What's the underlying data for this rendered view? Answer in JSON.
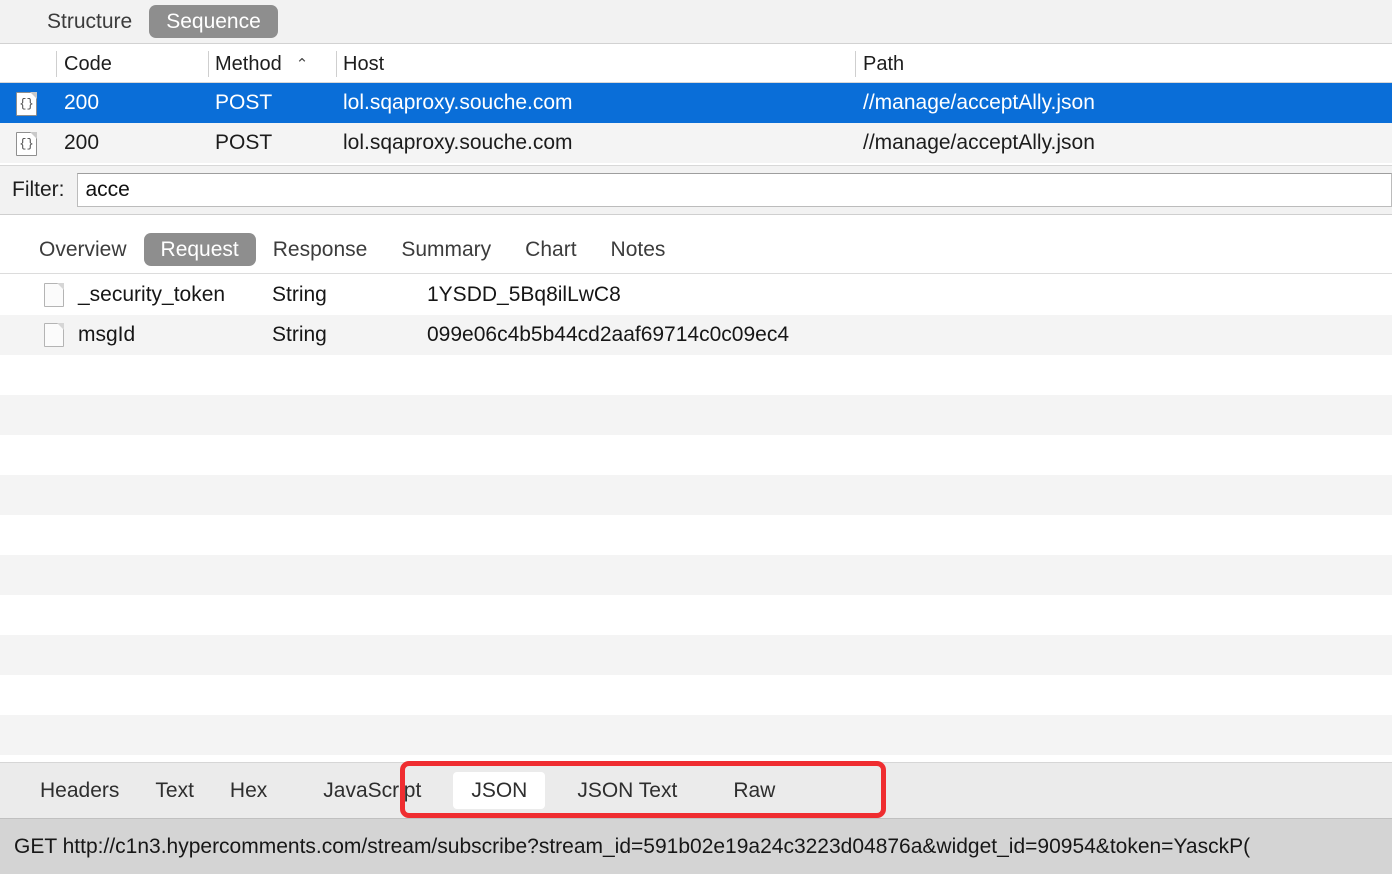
{
  "toolbar": {
    "segments": [
      {
        "label": "Structure",
        "active": false
      },
      {
        "label": "Sequence",
        "active": true
      }
    ]
  },
  "request_list": {
    "columns": [
      {
        "label": "Code"
      },
      {
        "label": "Method",
        "sort_caret": "⌃"
      },
      {
        "label": "Host"
      },
      {
        "label": "Path"
      }
    ],
    "rows": [
      {
        "icon": "json-document-icon",
        "code": "200",
        "method": "POST",
        "host": "lol.sqaproxy.souche.com",
        "path": "//manage/acceptAlly.json",
        "selected": true
      },
      {
        "icon": "json-document-icon",
        "code": "200",
        "method": "POST",
        "host": "lol.sqaproxy.souche.com",
        "path": "//manage/acceptAlly.json",
        "selected": false
      }
    ]
  },
  "filter": {
    "label": "Filter:",
    "value": "acce",
    "placeholder": ""
  },
  "detail_tabs": [
    {
      "label": "Overview",
      "active": false
    },
    {
      "label": "Request",
      "active": true
    },
    {
      "label": "Response",
      "active": false
    },
    {
      "label": "Summary",
      "active": false
    },
    {
      "label": "Chart",
      "active": false
    },
    {
      "label": "Notes",
      "active": false
    }
  ],
  "params": {
    "rows": [
      {
        "icon": "file-icon",
        "name": "_security_token",
        "type": "String",
        "value": "1YSDD_5Bq8ilLwC8"
      },
      {
        "icon": "file-icon",
        "name": "msgId",
        "type": "String",
        "value": "099e06c4b5b44cd2aaf69714c0c09ec4"
      }
    ]
  },
  "view_tabs": [
    {
      "label": "Headers",
      "active": false,
      "highlighted": false
    },
    {
      "label": "Text",
      "active": false,
      "highlighted": false
    },
    {
      "label": "Hex",
      "active": false,
      "highlighted": false
    },
    {
      "label": "JavaScript",
      "active": false,
      "highlighted": true
    },
    {
      "label": "JSON",
      "active": true,
      "highlighted": true
    },
    {
      "label": "JSON Text",
      "active": false,
      "highlighted": true
    },
    {
      "label": "Raw",
      "active": false,
      "highlighted": false
    }
  ],
  "annotation": {
    "shape": "rounded-rectangle",
    "color": "#ef2d30"
  },
  "statusbar": {
    "text": "GET http://c1n3.hypercomments.com/stream/subscribe?stream_id=591b02e19a24c3223d04876a&widget_id=90954&token=YasckP("
  },
  "colors": {
    "selection_blue": "#0a6ed8",
    "segment_active_gray": "#8e8e8e",
    "stripe_gray": "#f4f4f4",
    "annotation_red": "#ef2d30",
    "statusbar_gray": "#d4d4d4"
  }
}
